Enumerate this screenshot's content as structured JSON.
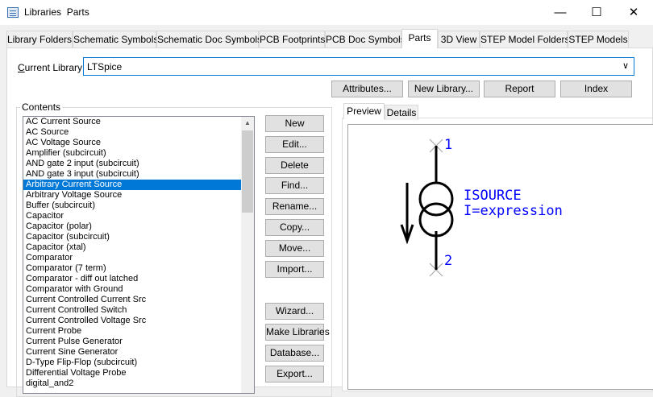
{
  "window": {
    "title": "Libraries  Parts",
    "minimize_icon": "minimize-icon",
    "maximize_icon": "maximize-icon",
    "close_icon": "close-icon"
  },
  "tabs": [
    {
      "label": "Library Folders"
    },
    {
      "label": "Schematic Symbols"
    },
    {
      "label": "Schematic Doc Symbols"
    },
    {
      "label": "PCB Footprints"
    },
    {
      "label": "PCB Doc Symbols"
    },
    {
      "label": "Parts",
      "active": true
    },
    {
      "label": "3D View"
    },
    {
      "label": "STEP Model Folders"
    },
    {
      "label": "STEP Models"
    }
  ],
  "current_library": {
    "label": "Current Library:",
    "value": "LTSpice"
  },
  "top_buttons": {
    "attributes": "Attributes...",
    "new_library": "New Library...",
    "report": "Report",
    "index": "Index"
  },
  "contents": {
    "legend": "Contents",
    "selected_index": 6,
    "items": [
      "AC Current Source",
      "AC Source",
      "AC Voltage Source",
      "Amplifier (subcircuit)",
      "AND gate 2 input (subcircuit)",
      "AND gate 3 input (subcircuit)",
      "Arbitrary Current Source",
      "Arbitrary Voltage Source",
      "Buffer (subcircuit)",
      "Capacitor",
      "Capacitor (polar)",
      "Capacitor (subcircuit)",
      "Capacitor (xtal)",
      "Comparator",
      "Comparator (7 term)",
      "Comparator - diff out latched",
      "Comparator with Ground",
      "Current Controlled Current Src",
      "Current Controlled Switch",
      "Current Controlled Voltage Src",
      "Current Probe",
      "Current Pulse Generator",
      "Current Sine Generator",
      "D-Type Flip-Flop (subcircuit)",
      "Differential Voltage Probe",
      "digital_and2"
    ]
  },
  "side_buttons": {
    "new": "New",
    "edit": "Edit...",
    "delete": "Delete",
    "find": "Find...",
    "rename": "Rename...",
    "copy": "Copy...",
    "move": "Move...",
    "import": "Import...",
    "wizard": "Wizard...",
    "make_libraries": "Make Libraries",
    "database": "Database...",
    "export": "Export..."
  },
  "preview_tabs": {
    "preview": "Preview",
    "details": "Details"
  },
  "symbol": {
    "pin1": "1",
    "pin2": "2",
    "name": "ISOURCE",
    "value": "I=expression",
    "text_color": "#0000ff",
    "line_color": "#000000"
  }
}
